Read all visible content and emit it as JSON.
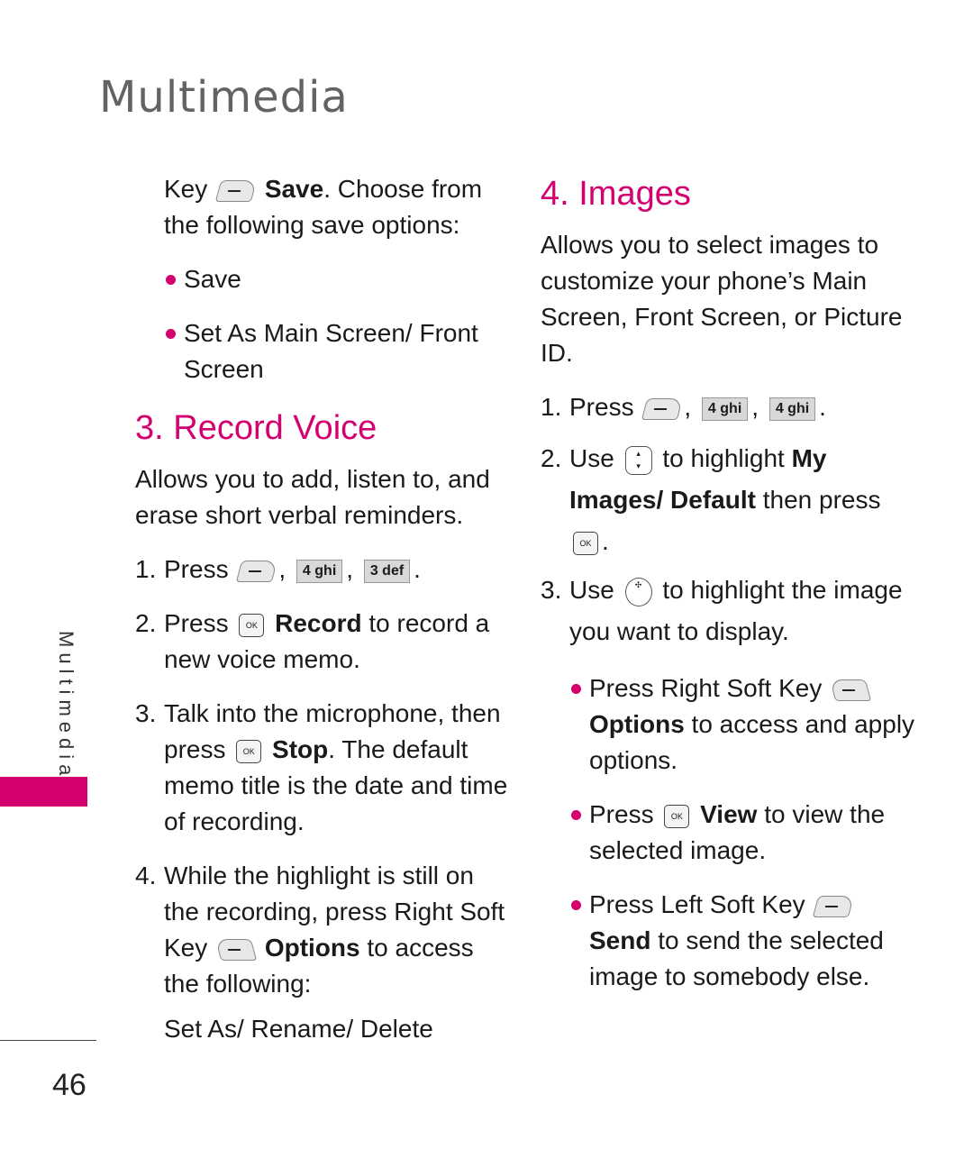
{
  "header": {
    "title": "Multimedia"
  },
  "sidebar": {
    "tab_label": "Multimedia",
    "accent_color": "#d4006f"
  },
  "footer": {
    "page_number": "46"
  },
  "left": {
    "intro_pre": "Key",
    "intro_bold": "Save",
    "intro_post": ". Choose from the following save options:",
    "bullets": [
      "Save",
      "Set As Main Screen/ Front Screen"
    ],
    "section_title": "3. Record Voice",
    "description": "Allows you to add, listen to, and erase short verbal reminders.",
    "steps": [
      {
        "num": "1.",
        "text": "Press",
        "keys": [
          "4 ghi",
          "3 def"
        ]
      },
      {
        "num": "2.",
        "pre": "Press",
        "bold": "Record",
        "post": "to record a new voice memo."
      },
      {
        "num": "3.",
        "pre": "Talk into the microphone, then press",
        "bold": "Stop",
        "post": ". The default memo title is the date and time of recording."
      },
      {
        "num": "4.",
        "pre": "While the highlight is still on the recording, press Right Soft Key",
        "bold": "Options",
        "post": "to access the following:"
      }
    ],
    "options_line": "Set As/ Rename/ Delete"
  },
  "right": {
    "section_title": "4. Images",
    "description": "Allows you to select images to customize your phone’s Main Screen, Front Screen, or Picture ID.",
    "steps": [
      {
        "num": "1.",
        "text": "Press",
        "keys": [
          "4 ghi",
          "4 ghi"
        ]
      },
      {
        "num": "2.",
        "pre": "Use",
        "mid": "to highlight",
        "bold": "My Images/ Default",
        "post": "then press"
      },
      {
        "num": "3.",
        "pre": "Use",
        "post": "to highlight the image you want to display."
      }
    ],
    "bullets": [
      {
        "pre": "Press Right Soft Key",
        "bold": "Options",
        "post": "to access and apply options."
      },
      {
        "pre": "Press",
        "bold": "View",
        "post": "to view the selected image."
      },
      {
        "pre": "Press Left Soft Key",
        "bold": "Send",
        "post": "to send the selected image to somebody else."
      }
    ]
  },
  "keys": {
    "ok_label": "OK"
  }
}
